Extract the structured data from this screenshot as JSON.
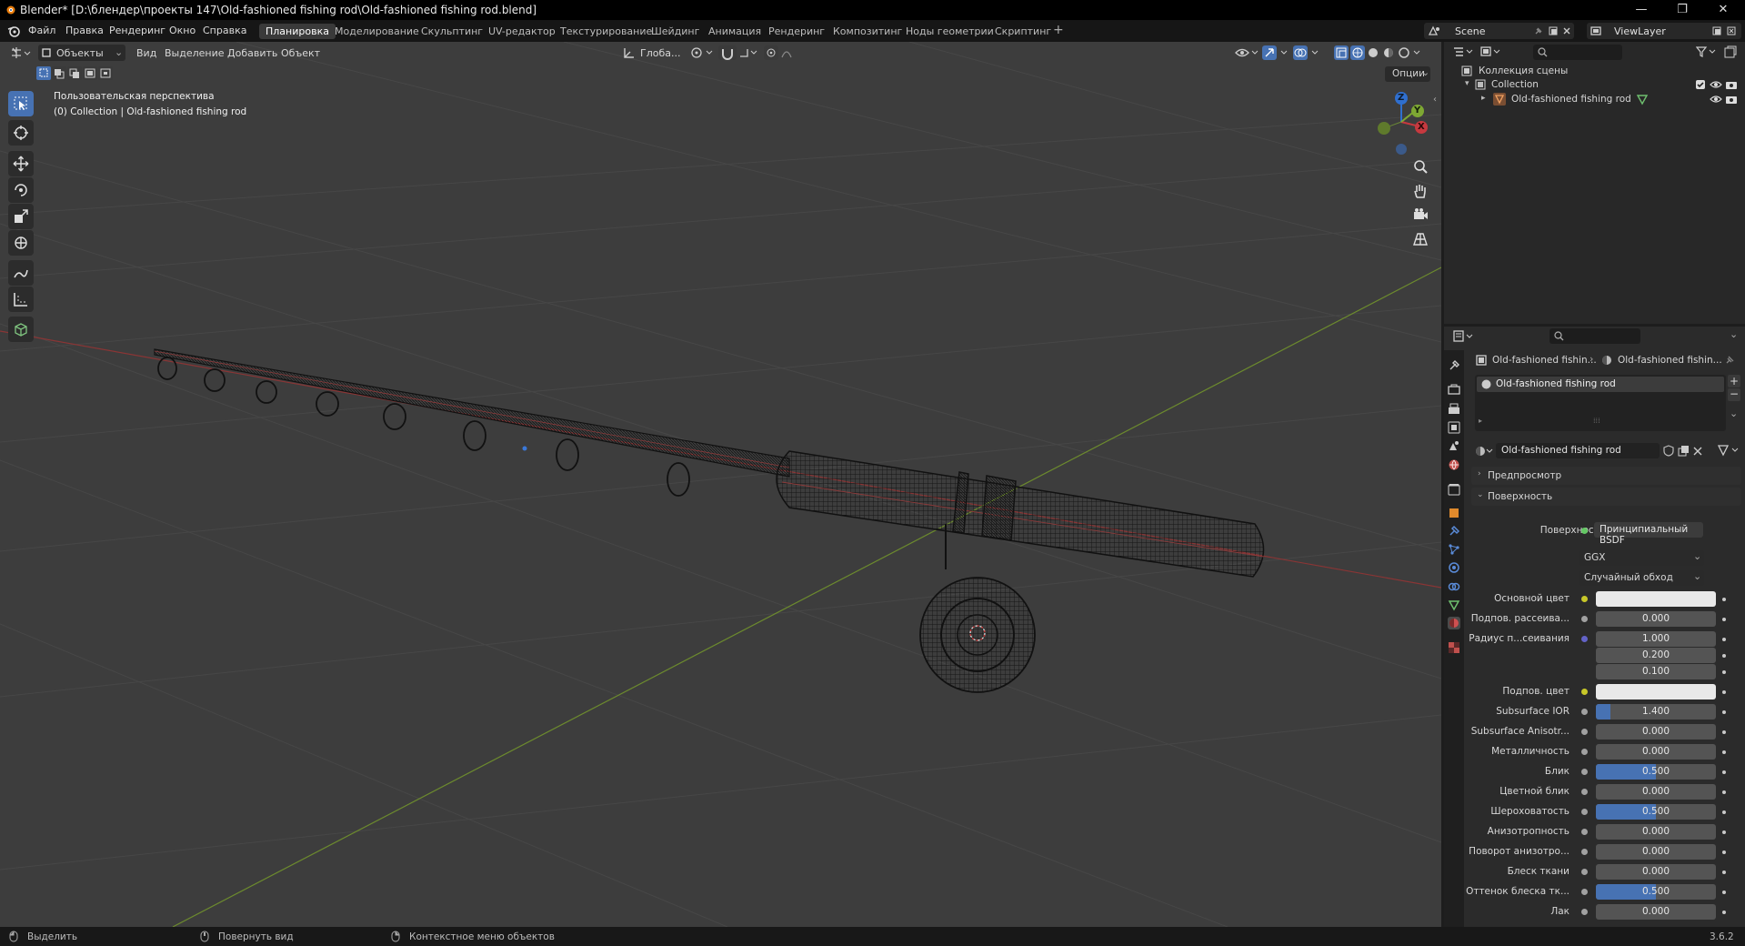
{
  "window": {
    "title": "Blender* [D:\\блендер\\проекты 147\\Old-fashioned fishing rod\\Old-fashioned fishing rod.blend]",
    "controls": [
      "—",
      "❐",
      "✕"
    ]
  },
  "menu": {
    "items": [
      "Файл",
      "Правка",
      "Рендеринг",
      "Окно",
      "Справка"
    ]
  },
  "workspaces": {
    "tabs": [
      "Планировка",
      "Моделирование",
      "Скульптинг",
      "UV-редактор",
      "Текстурирование",
      "Шейдинг",
      "Анимация",
      "Рендеринг",
      "Композитинг",
      "Ноды геометрии",
      "Скриптинг"
    ],
    "active": "Планировка",
    "add": "+"
  },
  "scene": {
    "name": "Scene",
    "view_layer": "ViewLayer"
  },
  "viewport": {
    "mode": "Объекты",
    "menus": [
      "Вид",
      "Выделение",
      "Добавить",
      "Объект"
    ],
    "orientation": "Глоба...",
    "options_label": "Опции",
    "info_line1": "Пользовательская перспектива",
    "info_line2": "(0) Collection | Old-fashioned fishing rod",
    "gizmo": {
      "x": "X",
      "y": "Y",
      "z": "Z"
    }
  },
  "tools": [
    "select-box",
    "cursor",
    "move",
    "rotate",
    "scale",
    "transform",
    "annotate",
    "measure",
    "add-cube"
  ],
  "outliner": {
    "search_placeholder": "",
    "root": "Коллекция сцены",
    "collection": "Collection",
    "object": "Old-fashioned fishing rod"
  },
  "properties": {
    "breadcrumb_object": "Old-fashioned fishin...",
    "breadcrumb_material": "Old-fashioned fishin...",
    "slot_name": "Old-fashioned fishing rod",
    "material_name": "Old-fashioned fishing rod",
    "panel_preview": "Предпросмотр",
    "panel_surface": "Поверхность",
    "surface_label": "Поверхность",
    "surface_value": "Принципиальный BSDF",
    "distribution": "GGX",
    "subsurface_method": "Случайный обход",
    "rows": [
      {
        "label": "Основной цвет",
        "value": "",
        "kind": "color",
        "fill": 0
      },
      {
        "label": "Подпов. рассеива...",
        "value": "0.000",
        "kind": "num",
        "fill": 0
      },
      {
        "label": "Радиус п...сеивания",
        "value": "1.000",
        "kind": "num",
        "fill": 0
      },
      {
        "label": "",
        "value": "0.200",
        "kind": "num",
        "fill": 0
      },
      {
        "label": "",
        "value": "0.100",
        "kind": "num",
        "fill": 0
      },
      {
        "label": "Подпов. цвет",
        "value": "",
        "kind": "color",
        "fill": 0
      },
      {
        "label": "Subsurface IOR",
        "value": "1.400",
        "kind": "num",
        "fill": 0.12
      },
      {
        "label": "Subsurface Anisotr...",
        "value": "0.000",
        "kind": "num",
        "fill": 0
      },
      {
        "label": "Металличность",
        "value": "0.000",
        "kind": "num",
        "fill": 0
      },
      {
        "label": "Блик",
        "value": "0.500",
        "kind": "num",
        "fill": 0.5
      },
      {
        "label": "Цветной блик",
        "value": "0.000",
        "kind": "num",
        "fill": 0
      },
      {
        "label": "Шероховатость",
        "value": "0.500",
        "kind": "num",
        "fill": 0.5
      },
      {
        "label": "Анизотропность",
        "value": "0.000",
        "kind": "num",
        "fill": 0
      },
      {
        "label": "Поворот анизотро...",
        "value": "0.000",
        "kind": "num",
        "fill": 0
      },
      {
        "label": "Блеск ткани",
        "value": "0.000",
        "kind": "num",
        "fill": 0
      },
      {
        "label": "Оттенок блеска тк...",
        "value": "0.500",
        "kind": "num",
        "fill": 0.5
      },
      {
        "label": "Лак",
        "value": "0.000",
        "kind": "num",
        "fill": 0
      }
    ]
  },
  "status": {
    "select": "Выделить",
    "rotate_view": "Повернуть вид",
    "context_menu": "Контекстное меню объектов",
    "version": "3.6.2"
  },
  "colors": {
    "accent": "#4772b3",
    "x_axis": "#c6393f",
    "y_axis": "#7ea833",
    "z_axis": "#2f6fcf"
  }
}
